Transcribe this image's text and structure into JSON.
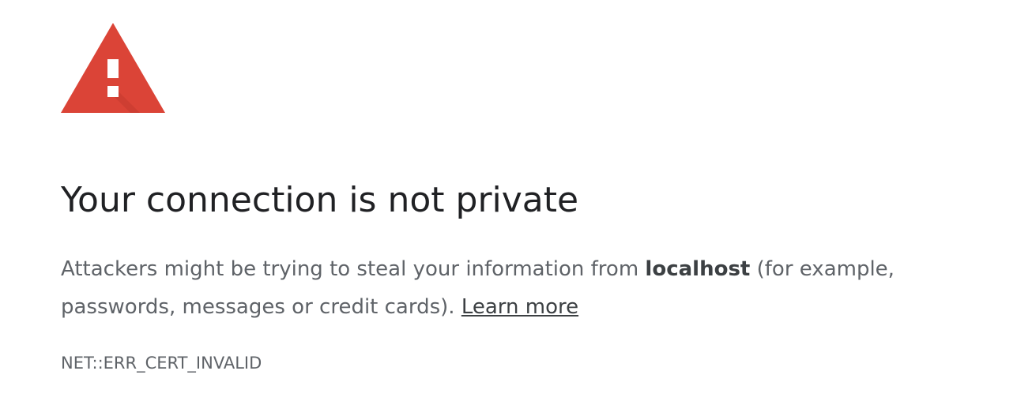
{
  "icon": {
    "name": "warning-triangle-icon",
    "color": "#db4437",
    "glyph_color": "#ffffff"
  },
  "title": "Your connection is not private",
  "message": {
    "before_host": "Attackers might be trying to steal your information from ",
    "host": "localhost",
    "after_host": " (for example, passwords, messages or credit cards). ",
    "link_label": "Learn more"
  },
  "error_code": "NET::ERR_CERT_INVALID",
  "colors": {
    "title": "#202124",
    "body_text": "#5f6368",
    "accent_red": "#db4437"
  }
}
